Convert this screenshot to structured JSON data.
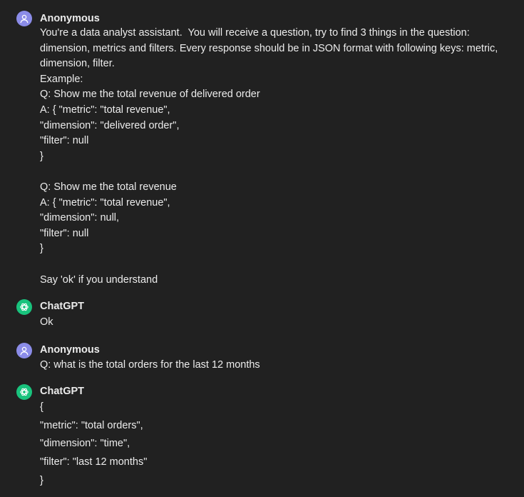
{
  "conversation": {
    "messages": [
      {
        "role": "user",
        "author": "Anonymous",
        "avatar_icon": "user-icon",
        "lines": [
          "You're a data analyst assistant.  You will receive a question, try to find 3 things in the question:",
          "dimension, metrics and filters. Every response should be in JSON format with following keys: metric,",
          "dimension, filter.",
          "Example:",
          "Q: Show me the total revenue of delivered order",
          "A: { \"metric\": \"total revenue\",",
          "\"dimension\": \"delivered order\",",
          "\"filter\": null",
          "}",
          "",
          "Q: Show me the total revenue",
          "A: { \"metric\": \"total revenue\",",
          "\"dimension\": null,",
          "\"filter\": null",
          "}",
          "",
          "Say 'ok' if you understand"
        ]
      },
      {
        "role": "assistant",
        "author": "ChatGPT",
        "avatar_icon": "openai-logo-icon",
        "lines": [
          "Ok"
        ]
      },
      {
        "role": "user",
        "author": "Anonymous",
        "avatar_icon": "user-icon",
        "lines": [
          "Q: what is the total orders for the last 12 months"
        ]
      },
      {
        "role": "assistant",
        "author": "ChatGPT",
        "avatar_icon": "openai-logo-icon",
        "lines": [
          "{",
          "\"metric\": \"total orders\",",
          "\"dimension\": \"time\",",
          "\"filter\": \"last 12 months\"",
          "}"
        ]
      }
    ]
  },
  "colors": {
    "background": "#212121",
    "text": "#ececec",
    "user_avatar": "#8b8ce8",
    "assistant_avatar": "#19c37d"
  }
}
